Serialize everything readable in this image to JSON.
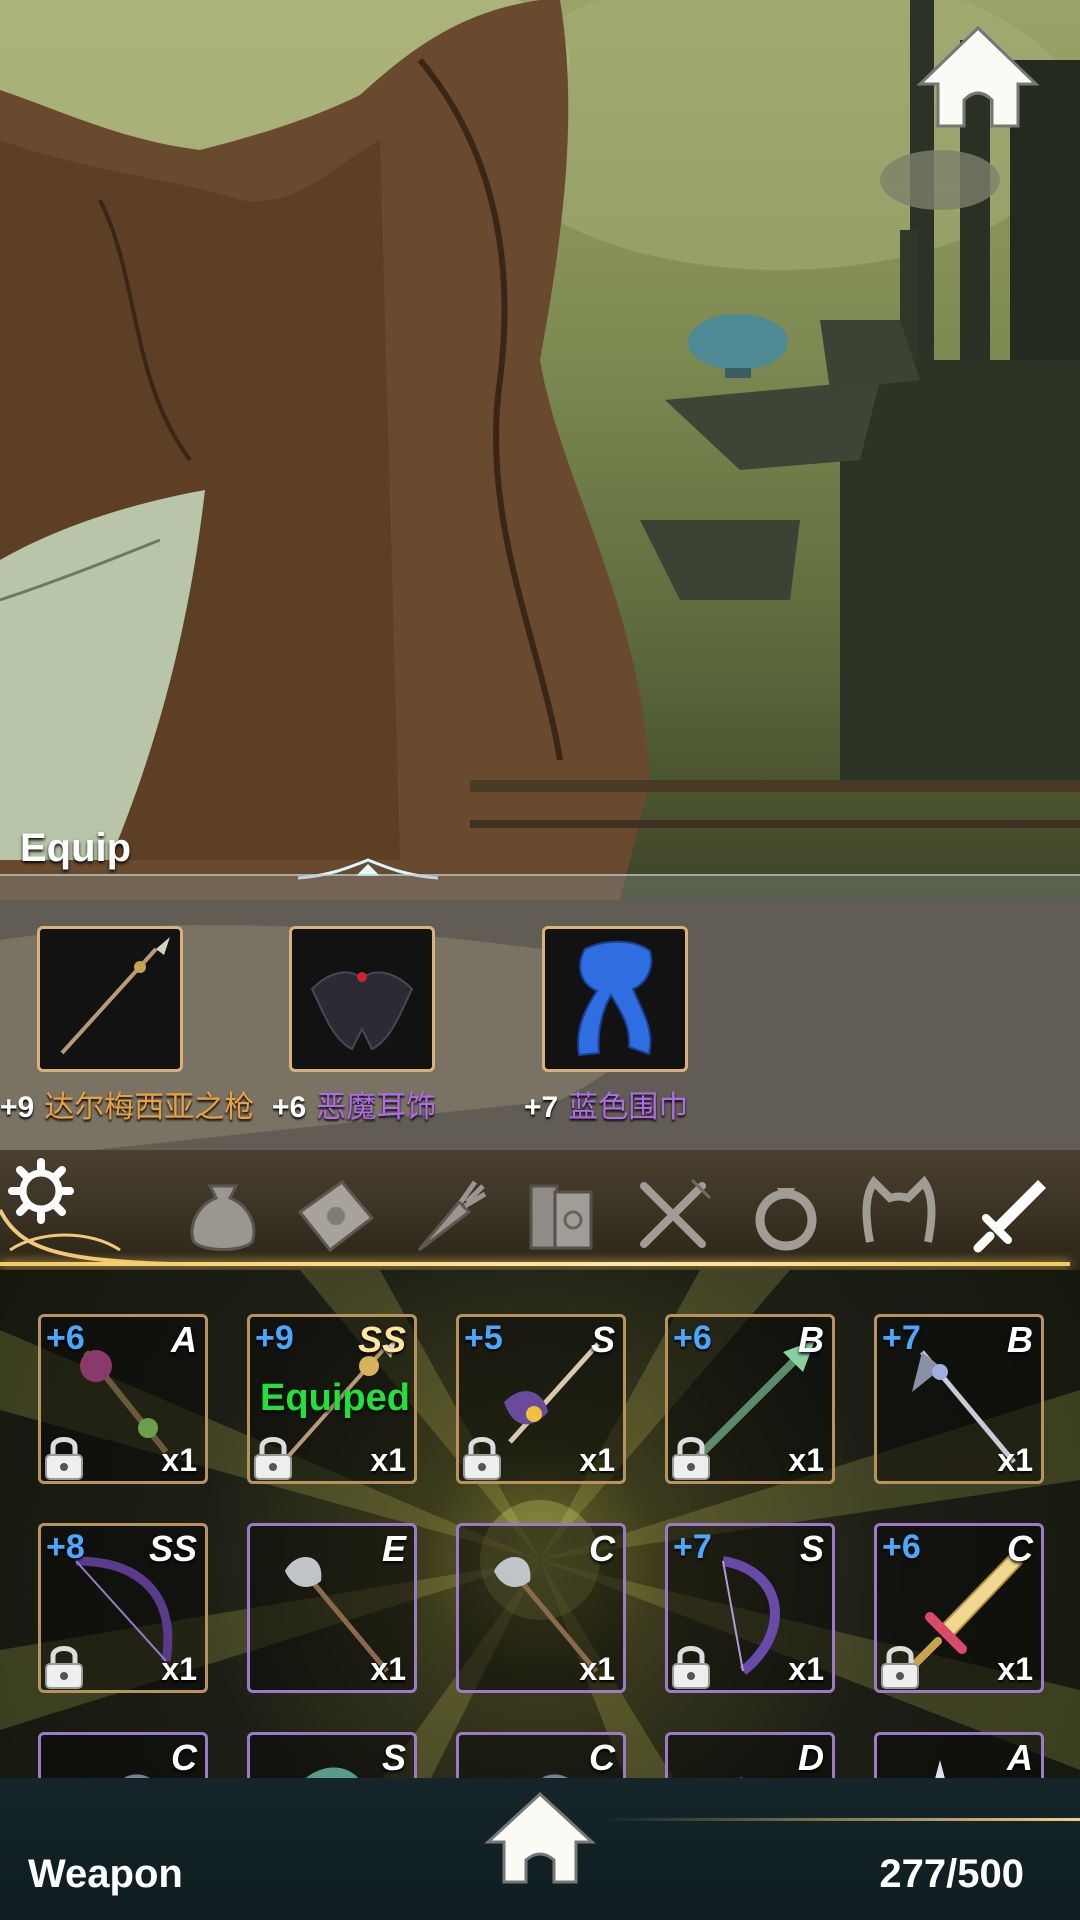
{
  "equip": {
    "title": "Equip",
    "slots": [
      {
        "plus": "+9",
        "name": "达尔梅西亚之枪",
        "name_color": "gold",
        "icon": "spear-icon"
      },
      {
        "plus": "+6",
        "name": "恶魔耳饰",
        "name_color": "purple",
        "icon": "bat-wing-earring-icon"
      },
      {
        "plus": "+7",
        "name": "蓝色围巾",
        "name_color": "purple",
        "icon": "blue-scarf-icon"
      }
    ]
  },
  "categories": [
    {
      "icon": "settings-gear-icon"
    },
    {
      "icon": "pouch-icon"
    },
    {
      "icon": "envelope-icon"
    },
    {
      "icon": "carrot-icon"
    },
    {
      "icon": "book-icon"
    },
    {
      "icon": "fork-knife-icon"
    },
    {
      "icon": "ring-icon"
    },
    {
      "icon": "cat-ear-headband-icon"
    },
    {
      "icon": "sword-icon",
      "selected": true
    }
  ],
  "inventory": {
    "items": [
      {
        "plus": "+6",
        "grade": "A",
        "qty": "x1",
        "locked": true,
        "equipped": false,
        "border": "gold",
        "icon": "staff-icon"
      },
      {
        "plus": "+9",
        "grade": "SS",
        "qty": "x1",
        "locked": true,
        "equipped": true,
        "equipped_label": "Equiped",
        "border": "gold",
        "icon": "spear-icon"
      },
      {
        "plus": "+5",
        "grade": "S",
        "qty": "x1",
        "locked": true,
        "equipped": false,
        "border": "gold",
        "icon": "winged-staff-icon"
      },
      {
        "plus": "+6",
        "grade": "B",
        "qty": "x1",
        "locked": true,
        "equipped": false,
        "border": "gold",
        "icon": "lance-icon"
      },
      {
        "plus": "+7",
        "grade": "B",
        "qty": "x1",
        "locked": false,
        "equipped": false,
        "border": "gold",
        "icon": "spike-lance-icon"
      },
      {
        "plus": "+8",
        "grade": "SS",
        "qty": "x1",
        "locked": true,
        "equipped": false,
        "border": "gold",
        "icon": "dark-bow-icon"
      },
      {
        "plus": "",
        "grade": "E",
        "qty": "x1",
        "locked": false,
        "equipped": false,
        "border": "purple",
        "icon": "halberd-icon"
      },
      {
        "plus": "",
        "grade": "C",
        "qty": "x1",
        "locked": false,
        "equipped": false,
        "border": "purple",
        "icon": "halberd-icon"
      },
      {
        "plus": "+7",
        "grade": "S",
        "qty": "x1",
        "locked": true,
        "equipped": false,
        "border": "purple",
        "icon": "bat-bow-icon"
      },
      {
        "plus": "+6",
        "grade": "C",
        "qty": "x1",
        "locked": true,
        "equipped": false,
        "border": "purple",
        "icon": "golden-sword-icon"
      },
      {
        "plus": "",
        "grade": "C",
        "qty": "",
        "locked": false,
        "equipped": false,
        "border": "purple",
        "icon": "weapon-icon"
      },
      {
        "plus": "",
        "grade": "S",
        "qty": "",
        "locked": false,
        "equipped": false,
        "border": "purple",
        "icon": "weapon-icon"
      },
      {
        "plus": "",
        "grade": "C",
        "qty": "",
        "locked": false,
        "equipped": false,
        "border": "purple",
        "icon": "weapon-icon"
      },
      {
        "plus": "",
        "grade": "D",
        "qty": "",
        "locked": false,
        "equipped": false,
        "border": "purple",
        "icon": "weapon-icon"
      },
      {
        "plus": "",
        "grade": "A",
        "qty": "",
        "locked": false,
        "equipped": false,
        "border": "purple",
        "icon": "weapon-icon"
      }
    ]
  },
  "footer": {
    "category_label": "Weapon",
    "capacity": "277/500"
  },
  "colors": {
    "gold_text": "#e8a040",
    "purple_text": "#b06be8",
    "plus_blue": "#4aa8ff",
    "equipped_green": "#23e03a",
    "gold_border": "#b8935e",
    "purple_border": "#9d7ac8"
  }
}
